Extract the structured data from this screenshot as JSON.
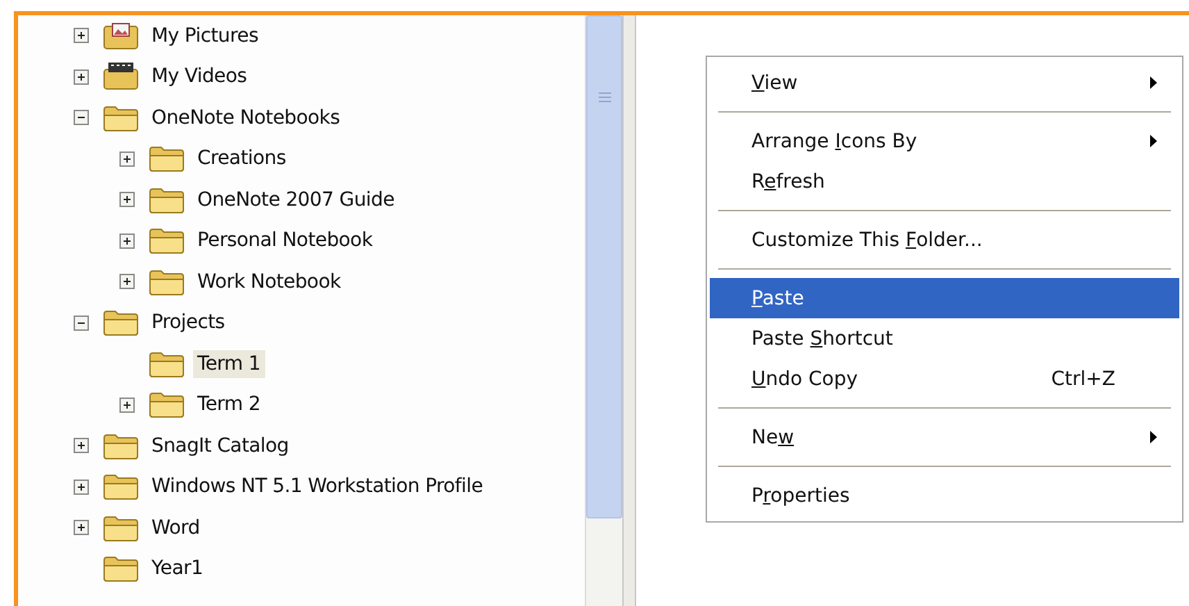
{
  "folder_tree": [
    {
      "label": "My Pictures",
      "kind": "pictures",
      "expandable": true,
      "expanded": false,
      "selected": false
    },
    {
      "label": "My Videos",
      "kind": "videos",
      "expandable": true,
      "expanded": false,
      "selected": false
    },
    {
      "label": "OneNote Notebooks",
      "kind": "folder",
      "expandable": true,
      "expanded": true,
      "selected": false,
      "children": [
        {
          "label": "Creations",
          "kind": "folder",
          "expandable": true,
          "expanded": false,
          "selected": false
        },
        {
          "label": "OneNote 2007 Guide",
          "kind": "folder",
          "expandable": true,
          "expanded": false,
          "selected": false
        },
        {
          "label": "Personal Notebook",
          "kind": "folder",
          "expandable": true,
          "expanded": false,
          "selected": false
        },
        {
          "label": "Work Notebook",
          "kind": "folder",
          "expandable": true,
          "expanded": false,
          "selected": false
        }
      ]
    },
    {
      "label": "Projects",
      "kind": "folder",
      "expandable": true,
      "expanded": true,
      "selected": false,
      "children": [
        {
          "label": "Term 1",
          "kind": "folder",
          "expandable": false,
          "selected": true
        },
        {
          "label": "Term 2",
          "kind": "folder",
          "expandable": true,
          "expanded": false,
          "selected": false
        }
      ]
    },
    {
      "label": "SnagIt Catalog",
      "kind": "folder",
      "expandable": true,
      "expanded": false,
      "selected": false
    },
    {
      "label": "Windows NT 5.1 Workstation Profile",
      "kind": "folder",
      "expandable": true,
      "expanded": false,
      "selected": false
    },
    {
      "label": "Word",
      "kind": "folder",
      "expandable": true,
      "expanded": false,
      "selected": false
    },
    {
      "label": "Year1",
      "kind": "folder",
      "expandable": false,
      "selected": false
    }
  ],
  "context_menu": [
    {
      "kind": "item",
      "label": {
        "key": "V",
        "after": "iew"
      },
      "submenu": true,
      "selected": false
    },
    {
      "kind": "separator"
    },
    {
      "kind": "item",
      "label": {
        "before": "Arrange ",
        "key": "I",
        "after": "cons By"
      },
      "submenu": true,
      "selected": false
    },
    {
      "kind": "item",
      "label": {
        "before": "R",
        "key": "e",
        "after": "fresh"
      },
      "submenu": false,
      "selected": false
    },
    {
      "kind": "separator"
    },
    {
      "kind": "item",
      "label": {
        "before": "Customize This ",
        "key": "F",
        "after": "older..."
      },
      "submenu": false,
      "selected": false
    },
    {
      "kind": "separator"
    },
    {
      "kind": "item",
      "label": {
        "key": "P",
        "after": "aste"
      },
      "submenu": false,
      "selected": true
    },
    {
      "kind": "item",
      "label": {
        "before": "Paste ",
        "key": "S",
        "after": "hortcut"
      },
      "submenu": false,
      "selected": false
    },
    {
      "kind": "item",
      "label": {
        "key": "U",
        "after": "ndo Copy"
      },
      "shortcut": "Ctrl+Z",
      "submenu": false,
      "selected": false
    },
    {
      "kind": "separator"
    },
    {
      "kind": "item",
      "label": {
        "before": "Ne",
        "key": "w"
      },
      "submenu": true,
      "selected": false
    },
    {
      "kind": "separator"
    },
    {
      "kind": "item",
      "label": {
        "before": "P",
        "key": "r",
        "after": "operties"
      },
      "submenu": false,
      "selected": false
    }
  ]
}
